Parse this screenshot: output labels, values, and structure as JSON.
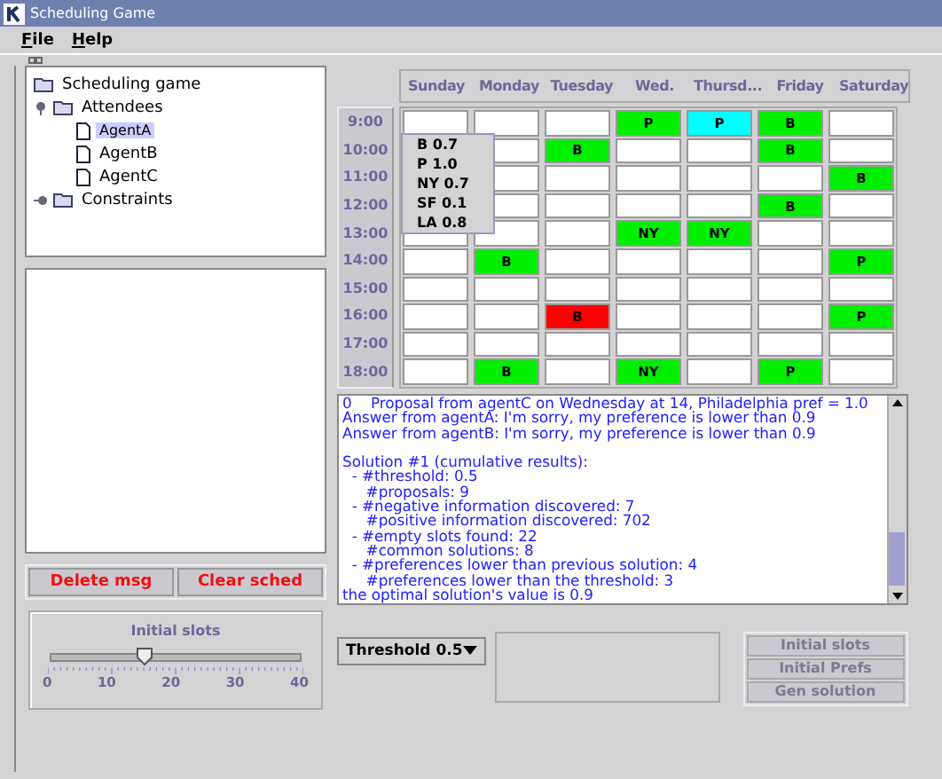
{
  "window": {
    "title": "Scheduling Game"
  },
  "menu": [
    {
      "label": "File"
    },
    {
      "label": "Help"
    }
  ],
  "tree": [
    {
      "label": "Scheduling game",
      "kind": "folder",
      "selected": false,
      "children": [
        {
          "label": "Attendees",
          "kind": "folder",
          "expanded": true,
          "selected": false,
          "children": [
            {
              "label": "AgentA",
              "kind": "file",
              "selected": true
            },
            {
              "label": "AgentB",
              "kind": "file",
              "selected": false
            },
            {
              "label": "AgentC",
              "kind": "file",
              "selected": false
            }
          ]
        },
        {
          "label": "Constraints",
          "kind": "folder",
          "expanded": false,
          "selected": false
        }
      ]
    }
  ],
  "left_buttons": [
    "Delete msg",
    "Clear sched"
  ],
  "slider": {
    "title": "Initial slots",
    "level": 0.375,
    "tick_labels": [
      "0",
      "10",
      "20",
      "30",
      "40"
    ]
  },
  "schedule": {
    "days": [
      "Sunday",
      "Monday",
      "Tuesday",
      "Wed.",
      "Thursd...",
      "Friday",
      "Saturday"
    ],
    "rows": [
      {
        "time": "9:00",
        "cells": [
          {
            "color": "#ffffff"
          },
          {
            "color": "#ffffff"
          },
          {
            "color": "#ffffff"
          },
          {
            "text": "P",
            "color": "#00ee00"
          },
          {
            "text": "P",
            "color": "#00ffff"
          },
          {
            "text": "B",
            "color": "#00ee00"
          },
          {
            "color": "#ffffff"
          }
        ]
      },
      {
        "time": "10:00",
        "cells": [
          null,
          {
            "color": "#ffffff"
          },
          {
            "text": "B",
            "color": "#00ee00"
          },
          {
            "color": "#ffffff"
          },
          {
            "color": "#ffffff"
          },
          {
            "text": "B",
            "color": "#00ee00"
          },
          {
            "color": "#ffffff"
          }
        ]
      },
      {
        "time": "11:00",
        "cells": [
          null,
          {
            "color": "#ffffff"
          },
          {
            "color": "#ffffff"
          },
          {
            "color": "#ffffff"
          },
          {
            "color": "#ffffff"
          },
          {
            "color": "#ffffff"
          },
          {
            "text": "B",
            "color": "#00ee00"
          }
        ]
      },
      {
        "time": "12:00",
        "cells": [
          null,
          {
            "color": "#ffffff"
          },
          {
            "color": "#ffffff"
          },
          {
            "color": "#ffffff"
          },
          {
            "color": "#ffffff"
          },
          {
            "text": "B",
            "color": "#00ee00"
          },
          {
            "color": "#ffffff"
          }
        ]
      },
      {
        "time": "13:00",
        "cells": [
          {
            "color": "#ffffff"
          },
          {
            "color": "#ffffff"
          },
          {
            "color": "#ffffff"
          },
          {
            "text": "NY",
            "color": "#00ee00"
          },
          {
            "text": "NY",
            "color": "#00ee00"
          },
          {
            "color": "#ffffff"
          },
          {
            "color": "#ffffff"
          }
        ]
      },
      {
        "time": "14:00",
        "cells": [
          {
            "color": "#ffffff"
          },
          {
            "text": "B",
            "color": "#00ee00"
          },
          {
            "color": "#ffffff"
          },
          {
            "color": "#ffffff"
          },
          {
            "color": "#ffffff"
          },
          {
            "color": "#ffffff"
          },
          {
            "text": "P",
            "color": "#00ee00"
          }
        ]
      },
      {
        "time": "15:00",
        "cells": [
          {
            "color": "#ffffff"
          },
          {
            "color": "#ffffff"
          },
          {
            "color": "#ffffff"
          },
          {
            "color": "#ffffff"
          },
          {
            "color": "#ffffff"
          },
          {
            "color": "#ffffff"
          },
          {
            "color": "#ffffff"
          }
        ]
      },
      {
        "time": "16:00",
        "cells": [
          {
            "color": "#ffffff"
          },
          {
            "color": "#ffffff"
          },
          {
            "text": "B",
            "color": "#ff0000"
          },
          {
            "color": "#ffffff"
          },
          {
            "color": "#ffffff"
          },
          {
            "color": "#ffffff"
          },
          {
            "text": "P",
            "color": "#00ee00"
          }
        ]
      },
      {
        "time": "17:00",
        "cells": [
          {
            "color": "#ffffff"
          },
          {
            "color": "#ffffff"
          },
          {
            "color": "#ffffff"
          },
          {
            "color": "#ffffff"
          },
          {
            "color": "#ffffff"
          },
          {
            "color": "#ffffff"
          },
          {
            "color": "#ffffff"
          }
        ]
      },
      {
        "time": "18:00",
        "cells": [
          {
            "color": "#ffffff"
          },
          {
            "text": "B",
            "color": "#00ee00"
          },
          {
            "color": "#ffffff"
          },
          {
            "text": "NY",
            "color": "#00ee00"
          },
          {
            "color": "#ffffff"
          },
          {
            "text": "P",
            "color": "#00ee00"
          },
          {
            "color": "#ffffff"
          }
        ]
      }
    ],
    "tooltip": [
      "B 0.7",
      "P 1.0",
      "NY 0.7",
      "SF 0.1",
      "LA 0.8"
    ]
  },
  "log": [
    [
      "0    Proposal from agentC on Wednesday at 14, Philadelphia pref = 1.0",
      "Answer from agentA: I'm sorry, my preference is lower than 0.9",
      "Answer from agentB: I'm sorry, my preference is lower than 0.9"
    ],
    [
      "Solution #1 (cumulative results):",
      "  - #threshold: 0.5",
      "     #proposals: 9",
      "  - #negative information discovered: 7",
      "     #positive information discovered: 702",
      "  - #empty slots found: 22",
      "     #common solutions: 8",
      "  - #preferences lower than previous solution: 4",
      "     #preferences lower than the threshold: 3",
      "the optimal solution's value is 0.9"
    ]
  ],
  "threshold": {
    "value": "Threshold 0.5"
  },
  "right_buttons": [
    {
      "label": "Initial slots",
      "disabled": true
    },
    {
      "label": "Initial Prefs",
      "disabled": true
    },
    {
      "label": "Gen solution",
      "disabled": true
    }
  ]
}
